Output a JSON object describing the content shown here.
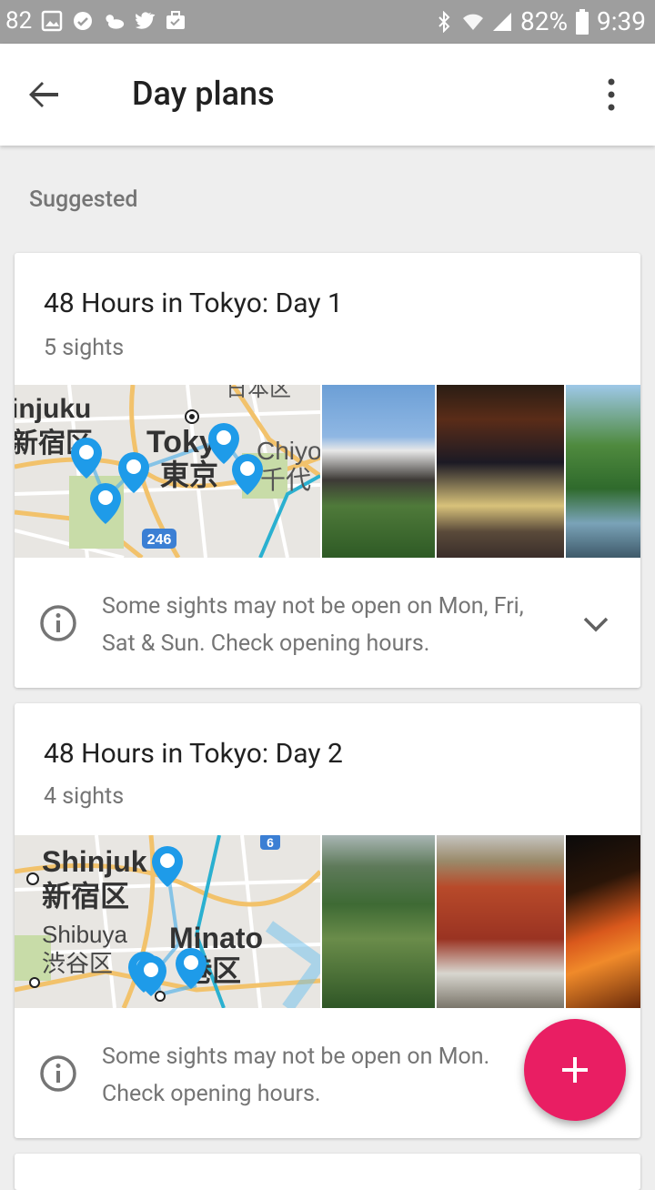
{
  "status_bar": {
    "left_number": "82",
    "battery_percent": "82%",
    "time": "9:39",
    "icons": [
      "image-icon",
      "sync-icon",
      "weather-icon",
      "twitter-icon",
      "briefcase-icon",
      "bluetooth-icon",
      "wifi-icon",
      "signal-icon",
      "battery-icon"
    ]
  },
  "app_bar": {
    "title": "Day plans"
  },
  "section_label": "Suggested",
  "cards": [
    {
      "title": "48 Hours in Tokyo: Day 1",
      "subtitle": "5 sights",
      "map_labels": {
        "l1": "injuku",
        "l2": "新宿区",
        "l3": "Tokyo",
        "l4": "東京",
        "l5": "Chiyo",
        "l6": "千代",
        "l7": "日本区",
        "badge": "246"
      },
      "notice": "Some sights may not be open on Mon, Fri, Sat & Sun. Check opening hours."
    },
    {
      "title": "48 Hours in Tokyo: Day 2",
      "subtitle": "4 sights",
      "map_labels": {
        "l1": "Shinjuk",
        "l2": "新宿区",
        "l3": "Shibuya",
        "l4": "渋谷区",
        "l5": "Minato",
        "l6": "港区",
        "badge": "6"
      },
      "notice": "Some sights may not be open on Mon. Check opening hours."
    }
  ],
  "colors": {
    "accent": "#e91e63",
    "pin": "#1e9be9",
    "status_bar": "#9e9e9e"
  }
}
